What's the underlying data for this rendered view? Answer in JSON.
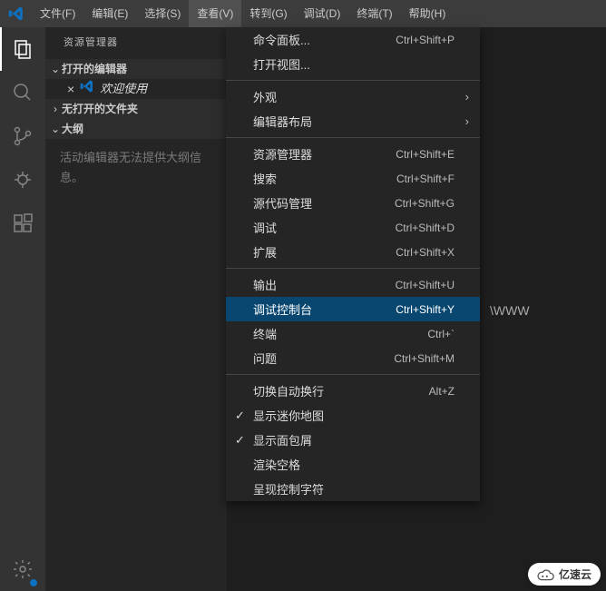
{
  "menubar": {
    "items": [
      {
        "label": "文件(F)"
      },
      {
        "label": "编辑(E)"
      },
      {
        "label": "选择(S)"
      },
      {
        "label": "查看(V)",
        "active": true
      },
      {
        "label": "转到(G)"
      },
      {
        "label": "调试(D)"
      },
      {
        "label": "终端(T)"
      },
      {
        "label": "帮助(H)"
      }
    ]
  },
  "sidebar": {
    "title": "资源管理器",
    "sections": {
      "open_editors": {
        "label": "打开的编辑器"
      },
      "welcome_tab": {
        "label": "欢迎使用"
      },
      "no_folder": {
        "label": "无打开的文件夹"
      },
      "outline": {
        "label": "大纲"
      },
      "outline_msg": "活动编辑器无法提供大纲信息。"
    }
  },
  "editor": {
    "bg_text": "\\WWW"
  },
  "dropdown": {
    "groups": [
      [
        {
          "label": "命令面板...",
          "shortcut": "Ctrl+Shift+P"
        },
        {
          "label": "打开视图..."
        }
      ],
      [
        {
          "label": "外观",
          "submenu": true
        },
        {
          "label": "编辑器布局",
          "submenu": true
        }
      ],
      [
        {
          "label": "资源管理器",
          "shortcut": "Ctrl+Shift+E"
        },
        {
          "label": "搜索",
          "shortcut": "Ctrl+Shift+F"
        },
        {
          "label": "源代码管理",
          "shortcut": "Ctrl+Shift+G"
        },
        {
          "label": "调试",
          "shortcut": "Ctrl+Shift+D"
        },
        {
          "label": "扩展",
          "shortcut": "Ctrl+Shift+X"
        }
      ],
      [
        {
          "label": "输出",
          "shortcut": "Ctrl+Shift+U"
        },
        {
          "label": "调试控制台",
          "shortcut": "Ctrl+Shift+Y",
          "highlight": true
        },
        {
          "label": "终端",
          "shortcut": "Ctrl+`"
        },
        {
          "label": "问题",
          "shortcut": "Ctrl+Shift+M"
        }
      ],
      [
        {
          "label": "切换自动换行",
          "shortcut": "Alt+Z"
        },
        {
          "label": "显示迷你地图",
          "checked": true
        },
        {
          "label": "显示面包屑",
          "checked": true
        },
        {
          "label": "渲染空格"
        },
        {
          "label": "呈现控制字符"
        }
      ]
    ]
  },
  "watermark": {
    "text": "亿速云"
  }
}
